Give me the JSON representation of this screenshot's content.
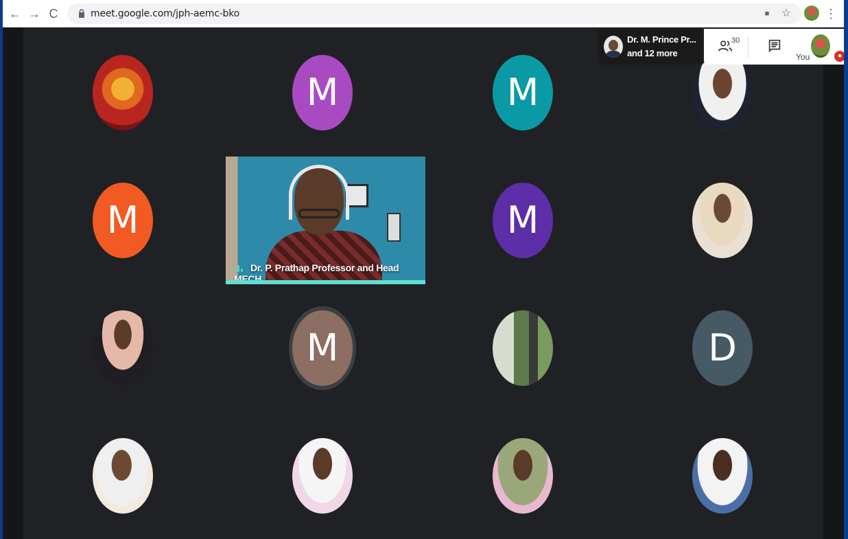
{
  "browser": {
    "url": "meet.google.com/jph-aemc-bko",
    "back_icon": "←",
    "forward_icon": "→",
    "reload_icon": "C",
    "camera_icon": "■",
    "star_icon": "☆",
    "menu_icon": "⋮"
  },
  "meet": {
    "speakers": {
      "name": "Dr. M. Prince Pr...",
      "more": "and 12 more"
    },
    "people_count": "30",
    "you_label": "You",
    "featured_video": {
      "label": "Dr. P. Prathap Professor and Head MECH"
    },
    "tiles": [
      {
        "name": "tile-ganesha-photo",
        "letter": "",
        "color": "#c2202a"
      },
      {
        "name": "tile-m-purple",
        "letter": "M",
        "color": "#a84bc2"
      },
      {
        "name": "tile-m-teal",
        "letter": "M",
        "color": "#0a9aa6"
      },
      {
        "name": "tile-photo-man-mustache",
        "letter": "",
        "color": "#f0f0f0"
      },
      {
        "name": "tile-m-orange",
        "letter": "M",
        "color": "#f15a22"
      },
      {
        "name": "tile-m-violet",
        "letter": "M",
        "color": "#5e2ea8"
      },
      {
        "name": "tile-photo-man-tie",
        "letter": "",
        "color": "#e9d9c0"
      },
      {
        "name": "tile-photo-man-suit",
        "letter": "",
        "color": "#d8d8d8"
      },
      {
        "name": "tile-m-brown",
        "letter": "M",
        "color": "#8d6e63"
      },
      {
        "name": "tile-photo-man-outdoor",
        "letter": "",
        "color": "#6b8a5a"
      },
      {
        "name": "tile-d-slate",
        "letter": "D",
        "color": "#455a64"
      },
      {
        "name": "tile-photo-man-beard",
        "letter": "",
        "color": "#efefef"
      },
      {
        "name": "tile-photo-man-glasses",
        "letter": "",
        "color": "#f5f5f5"
      },
      {
        "name": "tile-photo-man-field",
        "letter": "",
        "color": "#9aa77a"
      },
      {
        "name": "tile-photo-man-checked-shirt",
        "letter": "",
        "color": "#f3f3f3"
      }
    ]
  }
}
